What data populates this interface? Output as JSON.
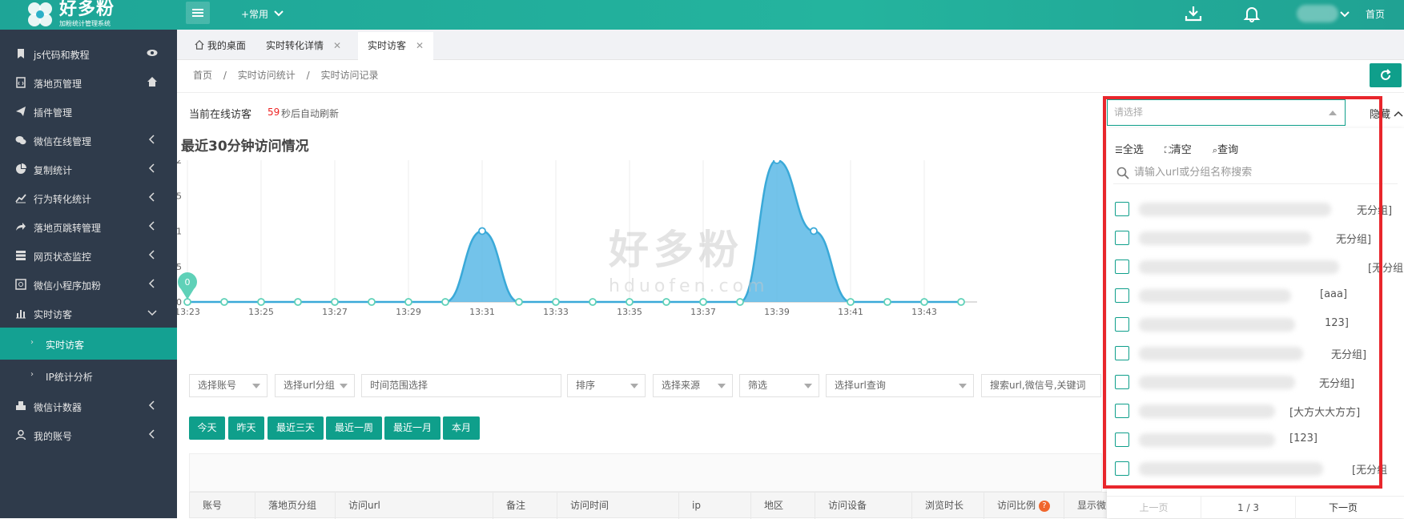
{
  "header": {
    "logo_text": "好多粉",
    "logo_sub": "加粉统计管理系统",
    "common_menu": "+常用",
    "home": "首页"
  },
  "sidebar": {
    "items": [
      {
        "label": "js代码和教程",
        "icon": "bookmark-icon",
        "arrow": "eye-icon"
      },
      {
        "label": "落地页管理",
        "icon": "file-code-icon",
        "arrow": "home-icon"
      },
      {
        "label": "插件管理",
        "icon": "paper-plane-icon",
        "arrow": ""
      },
      {
        "label": "微信在线管理",
        "icon": "wechat-icon",
        "arrow": "chevron-left-icon"
      },
      {
        "label": "复制统计",
        "icon": "pie-chart-icon",
        "arrow": "chevron-left-icon"
      },
      {
        "label": "行为转化统计",
        "icon": "line-chart-icon",
        "arrow": "chevron-left-icon"
      },
      {
        "label": "落地页跳转管理",
        "icon": "share-icon",
        "arrow": "chevron-left-icon"
      },
      {
        "label": "网页状态监控",
        "icon": "server-icon",
        "arrow": "chevron-left-icon"
      },
      {
        "label": "微信小程序加粉",
        "icon": "miniprogram-icon",
        "arrow": "chevron-left-icon"
      },
      {
        "label": "实时访客",
        "icon": "bar-chart-icon",
        "arrow": "chevron-down-icon"
      },
      {
        "label": "实时访客",
        "icon": "",
        "arrow": ""
      },
      {
        "label": "IP统计分析",
        "icon": "",
        "arrow": ""
      },
      {
        "label": "微信计数器",
        "icon": "cubes-icon",
        "arrow": "chevron-left-icon"
      },
      {
        "label": "我的账号",
        "icon": "user-icon",
        "arrow": "chevron-left-icon"
      }
    ]
  },
  "tabs": [
    {
      "label": "我的桌面"
    },
    {
      "label": "实时转化详情"
    },
    {
      "label": "实时访客"
    }
  ],
  "breadcrumb": [
    "首页",
    "/",
    "实时访问统计",
    "/",
    "实时访问记录"
  ],
  "online": {
    "title": "当前在线访客",
    "count": "59",
    "suffix": "秒后自动刷新"
  },
  "chart_data": {
    "type": "area",
    "title": "最近30分钟访问情况",
    "x": [
      "13:23",
      "13:24",
      "13:25",
      "13:26",
      "13:27",
      "13:28",
      "13:29",
      "13:30",
      "13:31",
      "13:32",
      "13:33",
      "13:34",
      "13:35",
      "13:36",
      "13:37",
      "13:38",
      "13:39",
      "13:40",
      "13:41",
      "13:42",
      "13:43",
      "13:44"
    ],
    "xticks": [
      "13:23",
      "13:25",
      "13:27",
      "13:29",
      "13:31",
      "13:33",
      "13:35",
      "13:37",
      "13:39",
      "13:41",
      "13:43"
    ],
    "values": [
      0,
      0,
      0,
      0,
      0,
      0,
      0,
      0,
      1,
      0,
      0,
      0,
      0,
      0,
      0,
      0,
      2,
      1,
      0,
      0,
      0,
      0
    ],
    "yticks": [
      "0",
      "0.5",
      "1",
      "1.5",
      "2"
    ],
    "ylim": [
      0,
      2
    ],
    "markers": [
      {
        "x": "13:23",
        "value": "0"
      },
      {
        "x": "13:39",
        "value": "2"
      }
    ],
    "color": "#5bb8e6"
  },
  "watermark": {
    "cn": "好多粉",
    "en": "hduofen.com"
  },
  "filters": [
    {
      "label": "选择账号"
    },
    {
      "label": "选择url分组"
    },
    {
      "label": "时间范围选择"
    },
    {
      "label": "排序"
    },
    {
      "label": "选择来源"
    },
    {
      "label": "筛选"
    },
    {
      "label": "选择url查询"
    },
    {
      "label": "搜索url,微信号,关键词"
    }
  ],
  "quick_buttons": [
    "今天",
    "昨天",
    "最近三天",
    "最近一周",
    "最近一月",
    "本月"
  ],
  "table_headers": [
    "账号",
    "落地页分组",
    "访问url",
    "备注",
    "访问时间",
    "ip",
    "地区",
    "访问设备",
    "浏览时长",
    "访问比例",
    "显示微"
  ],
  "dropdown": {
    "placeholder": "请选择",
    "hide": "隐藏",
    "tools": [
      "全选",
      "清空",
      "查询"
    ],
    "search_placeholder": "请输入url或分组名称搜索",
    "items": [
      {
        "group": "无分组]"
      },
      {
        "group": "无分组]"
      },
      {
        "group": "[无分组]"
      },
      {
        "group": "[aaa]"
      },
      {
        "group": "123]"
      },
      {
        "group": "无分组]"
      },
      {
        "group": "无分组]"
      },
      {
        "group": "[大方大大方方]"
      },
      {
        "group": "[123]"
      },
      {
        "group": "[无分组"
      }
    ],
    "pager": {
      "prev": "上一页",
      "page": "1 / 3",
      "next": "下一页"
    }
  },
  "colors": {
    "accent": "#0f9f8b",
    "sidebar": "#2f3b4b",
    "highlight": "#e8262c"
  }
}
